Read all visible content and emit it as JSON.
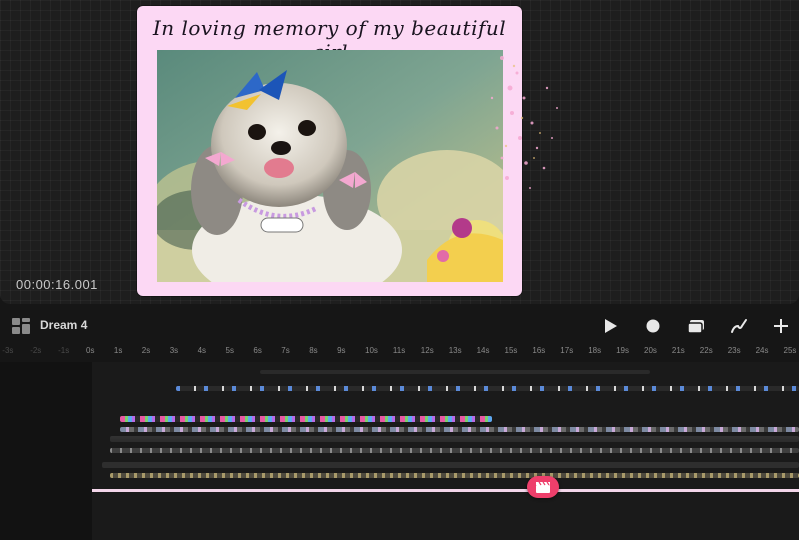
{
  "canvas": {
    "caption": "In loving memory of my beautiful girl",
    "timestamp": "00:00:16.001"
  },
  "toolbar": {
    "project_name": "Dream 4",
    "buttons": [
      "play-icon",
      "record-icon",
      "gallery-icon",
      "brush-icon",
      "plus-icon"
    ]
  },
  "ruler": {
    "labels": [
      "-3s",
      "-2s",
      "-1s",
      "0s",
      "1s",
      "2s",
      "3s",
      "4s",
      "5s",
      "6s",
      "7s",
      "8s",
      "9s",
      "10s",
      "11s",
      "12s",
      "13s",
      "14s",
      "15s",
      "16s",
      "17s",
      "18s",
      "19s",
      "20s",
      "21s",
      "22s",
      "23s",
      "24s",
      "25s"
    ]
  },
  "colors": {
    "accent": "#ee3f6b",
    "card": "#fcd8f4",
    "playhead": "#f3d6ea"
  }
}
